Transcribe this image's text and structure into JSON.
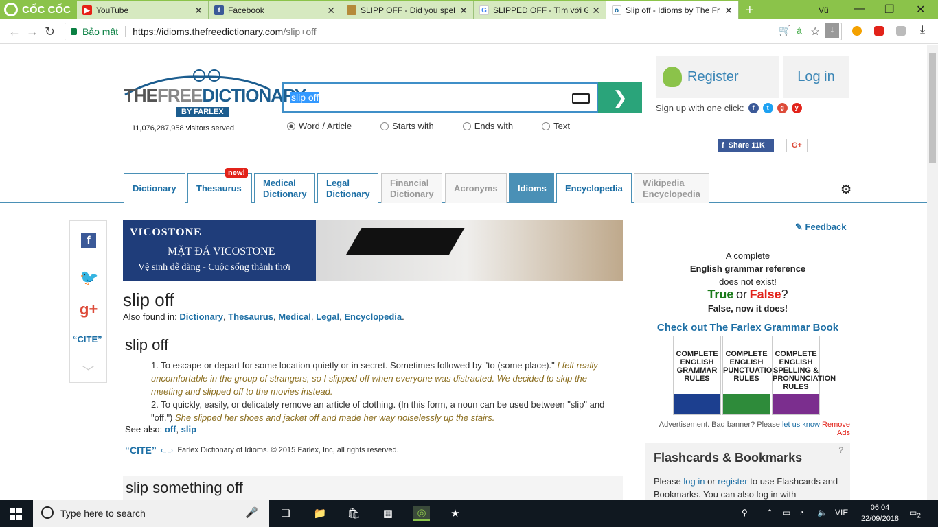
{
  "browser": {
    "brand": "CỐC CỐC",
    "tabs": [
      {
        "title": "YouTube",
        "icon": "youtube-icon",
        "active": false
      },
      {
        "title": "Facebook",
        "icon": "facebook-icon",
        "active": false
      },
      {
        "title": "SLIPP OFF - Did you spell i",
        "icon": "farlex-icon",
        "active": false
      },
      {
        "title": "SLIPPED OFF - Tìm với Goo",
        "icon": "google-icon",
        "active": false
      },
      {
        "title": "Slip off - Idioms by The Fre",
        "icon": "idioms-icon",
        "active": true
      }
    ],
    "profile": "Vũ",
    "secure_label": "Bảo mật",
    "url_host": "https://idioms.thefreedictionary.com",
    "url_rest": "/slip+off"
  },
  "header": {
    "logo_the": "THE",
    "logo_free": "FREE",
    "logo_dictionary": "DICTIONARY",
    "logo_byline": "BY FARLEX",
    "visitors": "11,076,287,958 visitors served",
    "search_value": "slip off",
    "search_options": [
      "Word / Article",
      "Starts with",
      "Ends with",
      "Text"
    ],
    "selected_option": "Word / Article",
    "register": "Register",
    "login": "Log in",
    "signup_text": "Sign up with one click:",
    "share_label": "Share 11K",
    "gplus_label": "G+"
  },
  "nav": {
    "tabs": [
      {
        "label": "Dictionary",
        "state": "normal"
      },
      {
        "label": "Thesaurus",
        "state": "normal"
      },
      {
        "label": "Medical Dictionary",
        "state": "normal"
      },
      {
        "label": "Legal Dictionary",
        "state": "normal"
      },
      {
        "label": "Financial Dictionary",
        "state": "grey"
      },
      {
        "label": "Acronyms",
        "state": "grey"
      },
      {
        "label": "Idioms",
        "state": "active"
      },
      {
        "label": "Encyclopedia",
        "state": "normal"
      },
      {
        "label": "Wikipedia Encyclopedia",
        "state": "grey"
      }
    ],
    "new_badge": "new!"
  },
  "rail": {
    "cite": "“CITE”"
  },
  "banner": {
    "brand": "VICOSTONE",
    "line1": "MẶT ĐÁ VICOSTONE",
    "line2": "Vệ sinh dễ dàng - Cuộc sống thảnh thơi"
  },
  "entry": {
    "title": "slip off",
    "also_found_label": "Also found in:",
    "also_found": [
      "Dictionary",
      "Thesaurus",
      "Medical",
      "Legal",
      "Encyclopedia"
    ],
    "heading": "slip off",
    "def1_text": "1. To escape or depart for some location quietly or in secret. Sometimes followed by \"to (some place).\"",
    "def1_example": "I felt really uncomfortable in the group of strangers, so I slipped off when everyone was distracted. We decided to skip the meeting and slipped off to the movies instead.",
    "def2_text": "2. To quickly, easily, or delicately remove an article of clothing. (In this form, a noun can be used between \"slip\" and \"off.\")",
    "def2_example": "She slipped her shoes and jacket off and made her way noiselessly up the stairs.",
    "see_also_label": "See also:",
    "see_also": [
      "off",
      "slip"
    ],
    "cite_label": "“CITE”",
    "source": "Farlex Dictionary of Idioms. © 2015 Farlex, Inc, all rights reserved.",
    "next_heading": "slip something off"
  },
  "sidebar": {
    "feedback": "Feedback",
    "gram_line1": "A complete",
    "gram_line2": "English grammar reference",
    "gram_line3": "does not exist!",
    "true_word": "True",
    "or_word": "or",
    "false_word": "False",
    "qmark": "?",
    "now_exists": "False, now it does!",
    "checkout": "Check out The Farlex Grammar Book",
    "books": [
      "COMPLETE ENGLISH GRAMMAR RULES",
      "COMPLETE ENGLISH PUNCTUATION RULES",
      "COMPLETE ENGLISH SPELLING & PRONUNCIATION RULES"
    ],
    "ad_text": "Advertisement. Bad banner? Please",
    "ad_link": "let us know",
    "remove_ads": "Remove Ads",
    "fb_title": "Flashcards & Bookmarks",
    "fb_q": "?",
    "fb_please": "Please",
    "fb_login": "log in",
    "fb_or": "or",
    "fb_register": "register",
    "fb_rest": "to use Flashcards and Bookmarks. You can also log in with"
  },
  "taskbar": {
    "search_placeholder": "Type here to search",
    "lang": "VIE",
    "time": "06:04",
    "date": "22/09/2018",
    "notif_count": "2"
  },
  "colors": {
    "accent": "#4a90b6",
    "link": "#1d6fa5",
    "go": "#2aa47a",
    "browser_green": "#8bc34a"
  }
}
